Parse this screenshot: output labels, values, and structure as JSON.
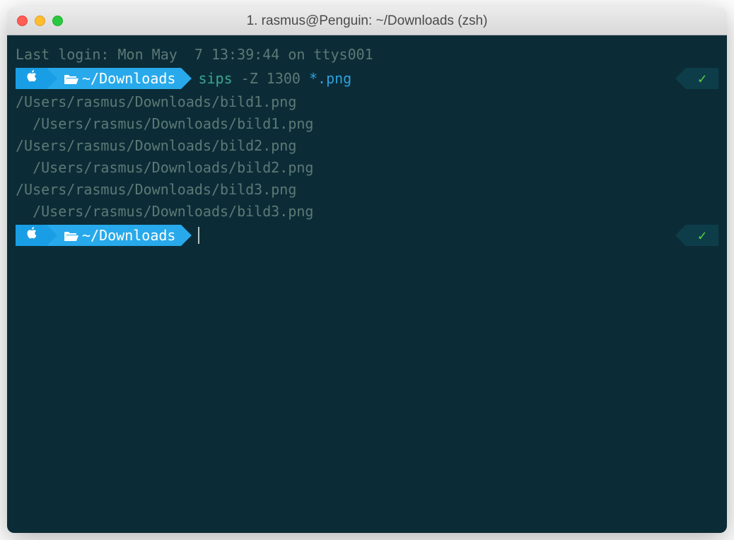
{
  "window": {
    "title": "1. rasmus@Penguin: ~/Downloads (zsh)"
  },
  "prompt": {
    "path": "~/Downloads"
  },
  "login_line": "Last login: Mon May  7 13:39:44 on ttys001",
  "command": {
    "name": "sips",
    "args": "-Z 1300",
    "glob": "*.png"
  },
  "output": [
    "/Users/rasmus/Downloads/bild1.png",
    "  /Users/rasmus/Downloads/bild1.png",
    "/Users/rasmus/Downloads/bild2.png",
    "  /Users/rasmus/Downloads/bild2.png",
    "/Users/rasmus/Downloads/bild3.png",
    "  /Users/rasmus/Downloads/bild3.png"
  ],
  "colors": {
    "terminal_bg": "#0b2c37",
    "prompt_dark": "#199ee5",
    "prompt_light": "#28a9eb",
    "text_muted": "#5c7975",
    "cmd_green": "#3aa78e",
    "glob_blue": "#2ea0db",
    "check_green": "#55d342"
  }
}
